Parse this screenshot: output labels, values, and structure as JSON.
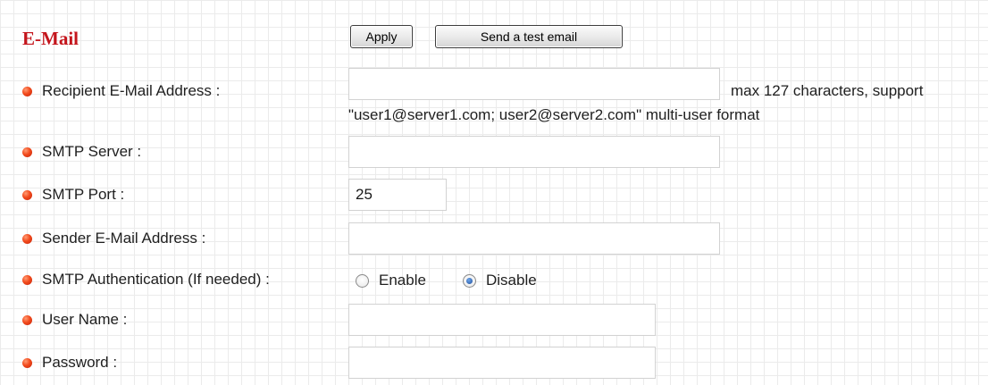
{
  "title": "E-Mail",
  "toolbar": {
    "apply_label": "Apply",
    "test_label": "Send a test email"
  },
  "fields": {
    "recipient": {
      "label": "Recipient E-Mail Address :",
      "value": "",
      "hint_line1": "max 127 characters, support",
      "hint_line2": "\"user1@server1.com; user2@server2.com\" multi-user format"
    },
    "smtp_server": {
      "label": "SMTP Server :",
      "value": ""
    },
    "smtp_port": {
      "label": "SMTP Port :",
      "value": "25"
    },
    "sender": {
      "label": "Sender E-Mail Address :",
      "value": ""
    },
    "auth": {
      "label": "SMTP Authentication (If needed) :",
      "options": [
        "Enable",
        "Disable"
      ],
      "selected": "Disable"
    },
    "username": {
      "label": "User Name :",
      "value": ""
    },
    "password": {
      "label": "Password :",
      "value": ""
    }
  },
  "colors": {
    "title": "#c4151c",
    "bullet": "#f24a1c",
    "grid": "#ebebeb"
  },
  "icons": {
    "bullet": "red-circle-bullet-icon"
  }
}
